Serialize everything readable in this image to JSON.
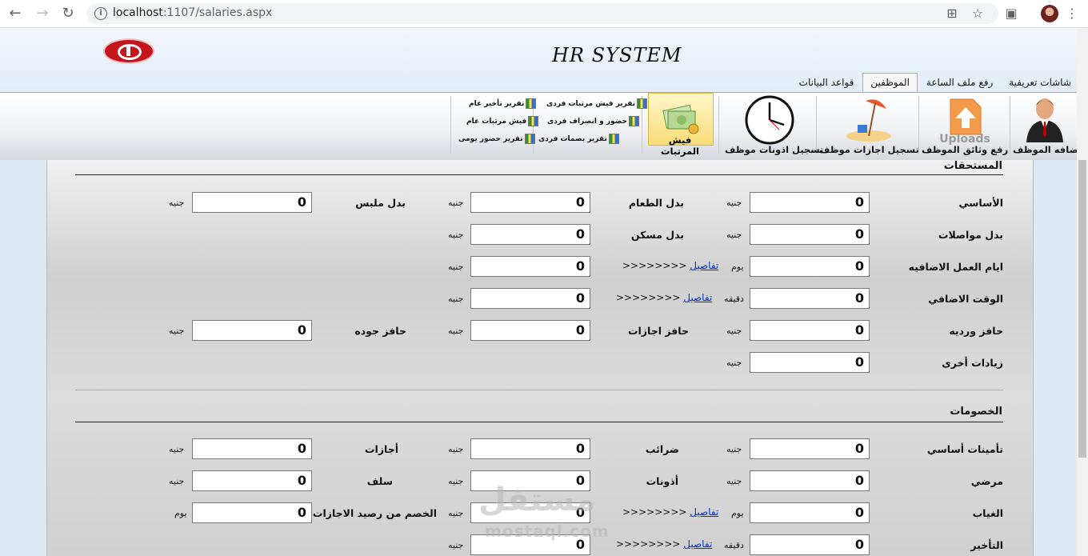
{
  "browser": {
    "url_host": "localhost",
    "url_rest": ":1107/salaries.aspx"
  },
  "app": {
    "title": "HR SYSTEM"
  },
  "tabs": [
    {
      "label": "شاشات تعريفية",
      "active": false
    },
    {
      "label": "رفع ملف الساعة",
      "active": false
    },
    {
      "label": "الموظفين",
      "active": true
    },
    {
      "label": "قواعد البيانات",
      "active": false
    }
  ],
  "ribbon": {
    "add_employee": "اضافه الموظف",
    "upload_docs": "رفع وثائق الموظف",
    "uploads_text": "Uploads",
    "vacations": "تسجيل اجازات موظف",
    "permissions": "تسجيل اذونات موظف",
    "salary_slip": "فيش المرتبات",
    "small": {
      "individual_slip_report": "تقرير فيش مرتبات فردى",
      "individual_attendance": "حضور و انصراف فردى",
      "individual_fingerprint_report": "تقرير بصمات فردى",
      "general_delay_report": "تقرير تأخير عام",
      "general_salary_slip": "فيش مرتبات عام",
      "daily_attendance_report": "تقرير حضور يومى"
    }
  },
  "earnings": {
    "title": "المستحقات",
    "basic": {
      "label": "الأساسي",
      "value": "0",
      "unit": "جنيه"
    },
    "food_allowance": {
      "label": "بدل الطعام",
      "value": "0",
      "unit": "جنيه"
    },
    "clothing_allowance": {
      "label": "بدل ملبس",
      "value": "0",
      "unit": "جنيه"
    },
    "transport_allowance": {
      "label": "بدل مواصلات",
      "value": "0",
      "unit": "جنيه"
    },
    "housing_allowance": {
      "label": "بدل مسكن",
      "value": "0",
      "unit": "جنيه"
    },
    "extra_days": {
      "label": "ايام العمل الاضافيه",
      "value": "0",
      "unit": "يوم",
      "details": "تفاصيل",
      "arrows": ">>>>>>>>",
      "amount": "0",
      "amount_unit": "جنيه"
    },
    "overtime": {
      "label": "الوقت الاضافي",
      "value": "0",
      "unit": "دقيقه",
      "details": "تفاصيل",
      "arrows": ">>>>>>>>",
      "amount": "0",
      "amount_unit": "جنيه"
    },
    "shift_incentive": {
      "label": "حافز ورديه",
      "value": "0",
      "unit": "جنيه"
    },
    "vacation_incentive": {
      "label": "حافز اجازات",
      "value": "0",
      "unit": "جنيه"
    },
    "quality_incentive": {
      "label": "حافز جوده",
      "value": "0",
      "unit": "جنيه"
    },
    "other_increases": {
      "label": "زيادات أخرى",
      "value": "0",
      "unit": "جنيه"
    }
  },
  "deductions": {
    "title": "الخصومات",
    "basic_insurance": {
      "label": "تأمينات أساسي",
      "value": "0",
      "unit": "جنيه"
    },
    "taxes": {
      "label": "ضرائب",
      "value": "0",
      "unit": "جنيه"
    },
    "vacations": {
      "label": "أجازات",
      "value": "0",
      "unit": "جنيه"
    },
    "sick": {
      "label": "مرضي",
      "value": "0",
      "unit": "جنيه"
    },
    "permissions": {
      "label": "أذونات",
      "value": "0",
      "unit": "جنيه"
    },
    "advances": {
      "label": "سلف",
      "value": "0",
      "unit": "جنيه"
    },
    "absence": {
      "label": "الغياب",
      "value": "0",
      "unit": "يوم",
      "details": "تفاصيل",
      "arrows": ">>>>>>>>",
      "amount": "0",
      "amount_unit": "جنيه"
    },
    "vacation_balance_deduction": {
      "label": "الخصم من رصيد الاجازات",
      "value": "0",
      "unit": "يوم"
    },
    "lateness": {
      "label": "التأخير",
      "value": "0",
      "unit": "دقيقه",
      "details": "تفاصيل",
      "arrows": ">>>>>>>>",
      "amount": "0",
      "amount_unit": "جنيه"
    }
  },
  "watermark": {
    "text": "مستقل",
    "sub": "mostaql.com"
  }
}
